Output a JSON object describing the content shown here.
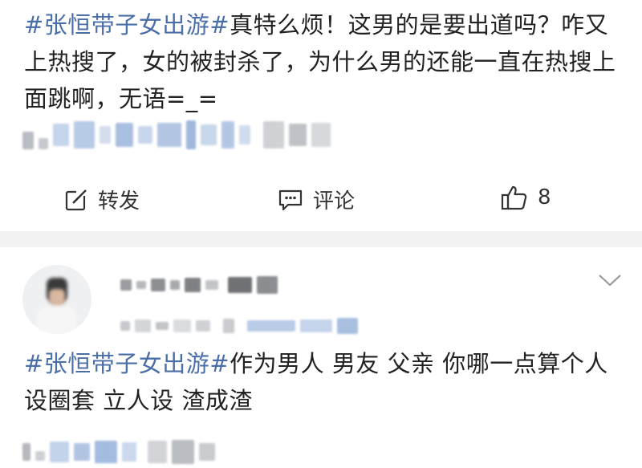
{
  "post": {
    "hashtag": "#张恒带子女出游#",
    "text": "真特么烦！这男的是要出道吗？咋又上热搜了，女的被封杀了，为什么男的还能一直在热搜上面跳啊，无语=_="
  },
  "actions": {
    "repost_label": "转发",
    "comment_label": "评论",
    "like_count": "8"
  },
  "comment": {
    "hashtag": "#张恒带子女出游#",
    "text": "作为男人 男友 父亲 你哪一点算个人 设圈套 立人设 渣成渣"
  },
  "icons": {
    "repost": "share-edit-icon",
    "comment": "comment-bubble-icon",
    "like": "thumbs-up-icon",
    "expand": "chevron-down-icon"
  },
  "colors": {
    "hashtag": "#4a6fa8",
    "text": "#222222",
    "divider": "#f2f2f2"
  }
}
